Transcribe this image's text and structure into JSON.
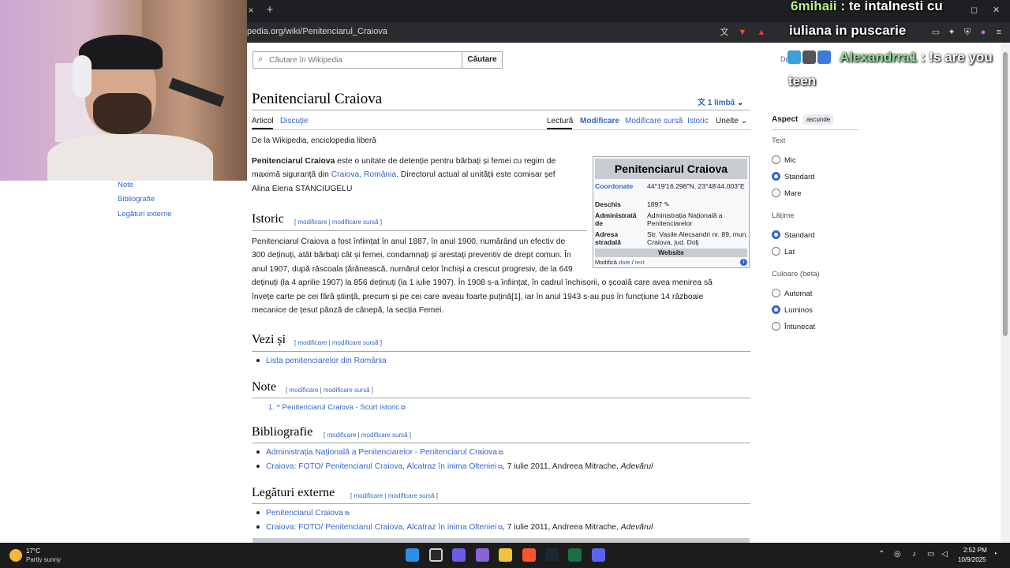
{
  "browser": {
    "tab_close_glyph": "×",
    "new_tab_glyph": "+",
    "url": "pedia.org/wiki/Penitenciarul_Craiova"
  },
  "search": {
    "placeholder": "Căutare în Wikipedia",
    "button_label": "Căutare"
  },
  "page": {
    "title": "Penitenciarul Craiova",
    "lang_label": "1 limbă",
    "tabs_left": [
      "Articol",
      "Discuție"
    ],
    "tabs_right": [
      "Lectură",
      "Modificare",
      "Modificare sursă",
      "Istoric",
      "Unelte"
    ],
    "tagline": "De la Wikipedia, enciclopedia liberă",
    "intro_lead": "Penitenciarul Craiova",
    "intro_rest1": " este o unitate de detenție pentru bărbați și femei cu regim de",
    "intro_rest2": "maximă siguranță din ",
    "intro_link1": "Craiova",
    "intro_link2": "România",
    "intro_rest3": ". Directorul actual al unității este comisar șef",
    "intro_rest4": "Alina Elena STANCIUGELU"
  },
  "sections": {
    "edit": "modificare",
    "edit_source": "modificare sursă",
    "istoric_h": "Istoric",
    "istoric_lines": [
      "Penitenciarul Craiova a fost înființat în anul 1887, în anul 1900, numărând un efectiv de",
      "300 deținuți, atât bărbați cât și femei, condamnați și arestați preventiv de drept comun. În",
      "anul 1907, după răscoala țărănească, numărul celor închiși a crescut progresiv, de la 649",
      "deținuți (la 4 aprilie 1907) la 856 deținuți (la 1 iulie 1907). În 1908 s-a înființat, în cadrul închisorii, o școală care avea menirea să",
      "învețe carte pe cei fără știință, precum și pe cei care aveau foarte puțină[1], iar în anul 1943 s-au pus în funcțiune 14 războaie",
      "mecanice de țesut pânză de cânepă, la secția Femei."
    ],
    "vezi_h": "Vezi și",
    "vezi_items": [
      "Lista penitenciarelor din România"
    ],
    "note_h": "Note",
    "note_items": [
      "1. ^ Penitenciarul Craiova - Scurt istoric"
    ],
    "biblio_h": "Bibliografie",
    "biblio_item1": "Administrația Națională a Penitenciarelor - Penitenciarul Craiova",
    "biblio_item2_link": "Craiova: FOTO/ Penitenciarul Craiova, Alcatraz în inima Olteniei",
    "biblio_item2_rest": ", 7 iulie 2011, Andreea Mitrache, ",
    "biblio_item2_pub": "Adevărul",
    "legaturi_h": "Legături externe",
    "legaturi_item1": "Penitenciarul Craiova",
    "legaturi_item2_link": "Craiova: FOTO/ Penitenciarul Craiova, Alcatraz în inima Olteniei",
    "legaturi_item2_rest": ", 7 iulie 2011, Andreea Mitrache, ",
    "legaturi_item2_pub": "Adevărul"
  },
  "infobox": {
    "title": "Penitenciarul Craiova",
    "rows": [
      {
        "label": "Coordonate",
        "value": "44°19′16.298″N, 23°48′44.003″E"
      },
      {
        "label": "Deschis",
        "value": "1897 ✎"
      },
      {
        "label": "Administrată de",
        "value": "Administrația Națională a Penitenciarelor"
      },
      {
        "label": "Adresa stradală",
        "value": "Str. Vasile Alecsandri nr. 89, mun. Craiova, jud. Dolj"
      }
    ],
    "website": "Website",
    "footer_prefix": "Modifică ",
    "footer_link1": "date",
    "footer_sep": " / ",
    "footer_link2": "text"
  },
  "sidebar_right": {
    "aspect": "Aspect",
    "hide": "ascunde",
    "text_h": "Text",
    "text_opts": [
      "Mic",
      "Standard",
      "Mare"
    ],
    "width_h": "Lățime",
    "width_opts": [
      "Standard",
      "Lat"
    ],
    "color_h": "Culoare (beta)",
    "color_opts": [
      "Automat",
      "Luminos",
      "Întunecat"
    ]
  },
  "toc_left": [
    "Note",
    "Bibliografie",
    "Legături externe"
  ],
  "dev_link": "Do",
  "chat": {
    "msg1_user": "6mihaii",
    "msg1_text": " : te intalnesti cu",
    "msg1_line2": "iuliana in puscarie",
    "msg2_user": "Alexandrra1",
    "msg2_text": " : !s are you",
    "msg2_line2": "teen"
  },
  "taskbar": {
    "temp": "17°C",
    "weather": "Partly sunny",
    "time": "2:52 PM",
    "date": "10/9/2025"
  },
  "colors": {
    "link": "#3366cc",
    "chat_user": "#b6f28a",
    "taskbar": "#1c1c1c"
  }
}
